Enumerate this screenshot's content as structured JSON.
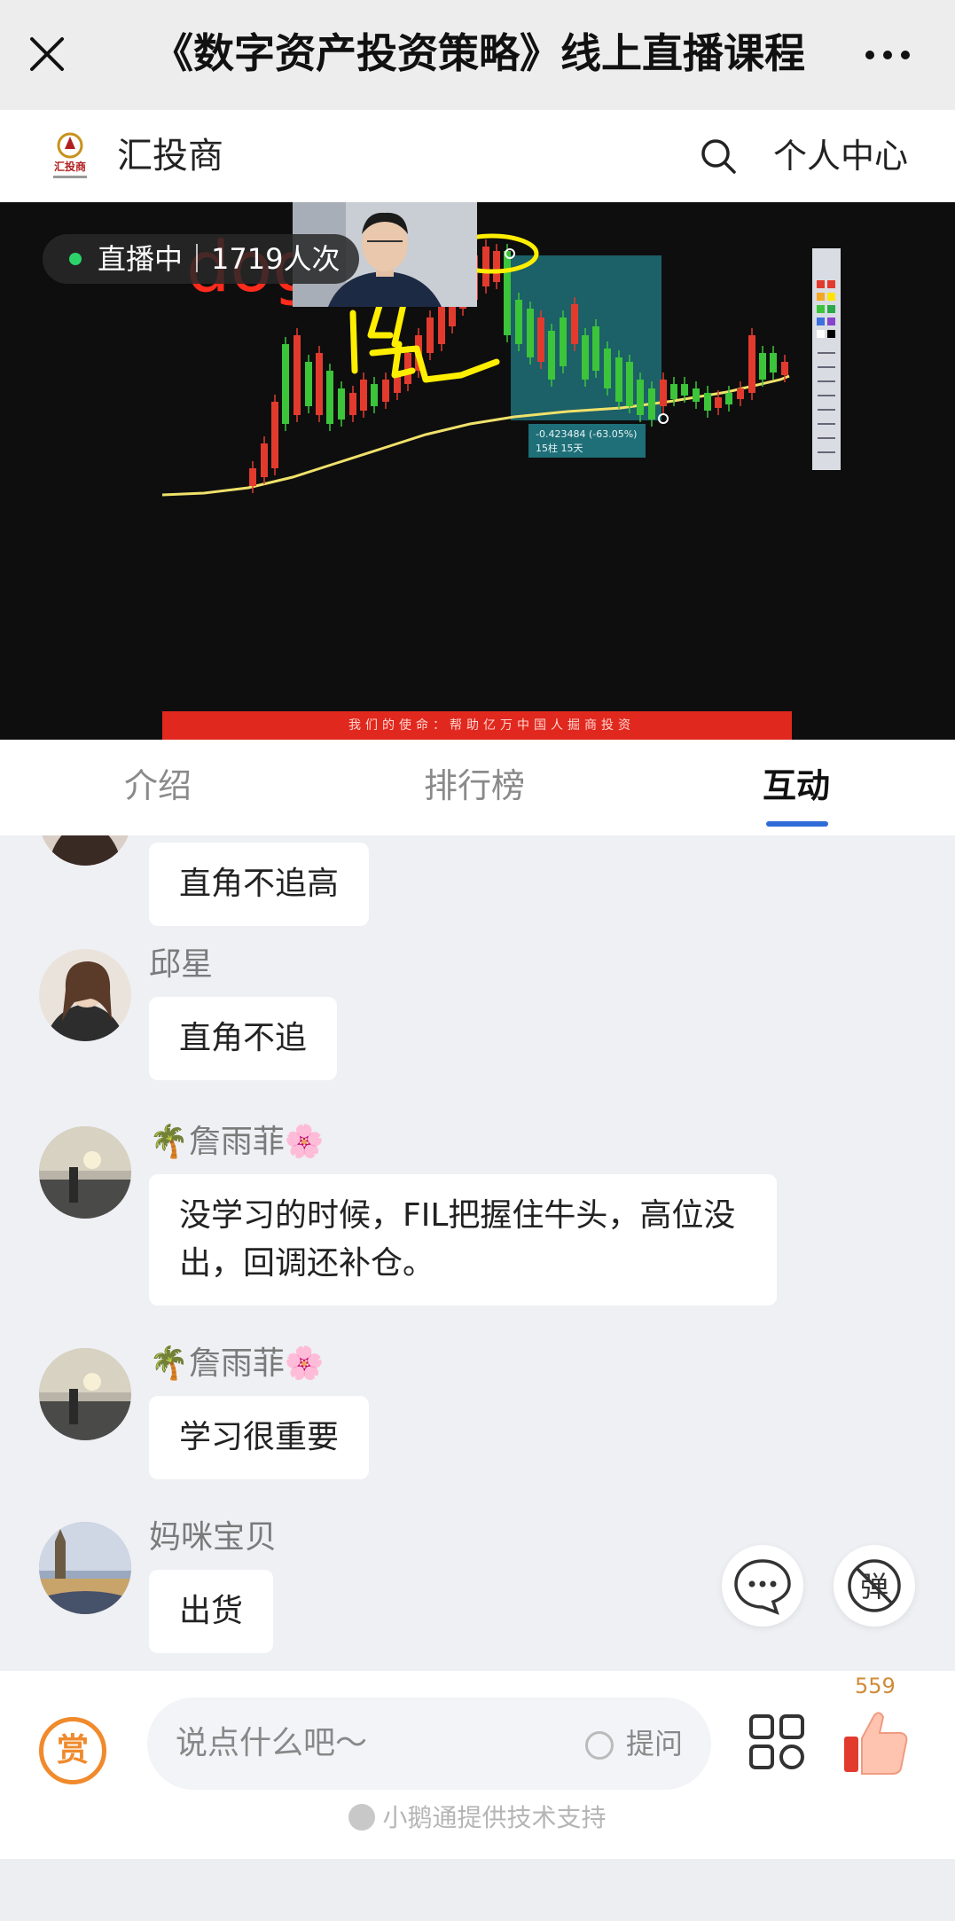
{
  "titlebar": {
    "close_icon": "close-icon",
    "title": "《数字资产投资策略》线上直播课程",
    "more_icon": "more-dots-icon"
  },
  "brand": {
    "logo_text": "汇投商",
    "name": "汇投商",
    "search_icon": "search-icon",
    "user_center": "个人中心"
  },
  "video": {
    "live_status": "直播中｜1719人次",
    "annotation_text": "doge",
    "measure_label": "-0.423484 (-63.05%)",
    "measure_sub": "15柱 15天",
    "banner_text": "我们的使命：帮助亿万中国人掘商投资",
    "colors": {
      "up": "#3cc43a",
      "down": "#e23b2e",
      "ma": "#f0e16a",
      "zone": "#1f6f78",
      "ink_red": "#ff2b1c",
      "ink_yellow": "#ffee00"
    }
  },
  "tabs": [
    {
      "label": "介绍",
      "active": false
    },
    {
      "label": "排行榜",
      "active": false
    },
    {
      "label": "互动",
      "active": true
    }
  ],
  "messages": [
    {
      "nick": "",
      "text": "直角不追高",
      "avatar": "avatar-partial"
    },
    {
      "nick": "邱星",
      "text": "直角不追",
      "avatar": "avatar-woman"
    },
    {
      "nick": "🌴詹雨菲🌸",
      "text": "没学习的时候，FIL把握住牛头，高位没出，回调还补仓。",
      "avatar": "avatar-sunset"
    },
    {
      "nick": "🌴詹雨菲🌸",
      "text": "学习很重要",
      "avatar": "avatar-sunset"
    },
    {
      "nick": "妈咪宝贝",
      "text": "出货",
      "avatar": "avatar-bigben"
    }
  ],
  "fabs": {
    "comment_icon": "comment-bubble-icon",
    "danmaku_off_label": "弹"
  },
  "bottom": {
    "reward_label": "赏",
    "input_placeholder": "说点什么吧～",
    "ask_label": "提问",
    "grid_icon": "grid-icon",
    "like_icon": "thumbs-up-icon",
    "like_count": "559",
    "powered_by": "小鹅通提供技术支持"
  }
}
